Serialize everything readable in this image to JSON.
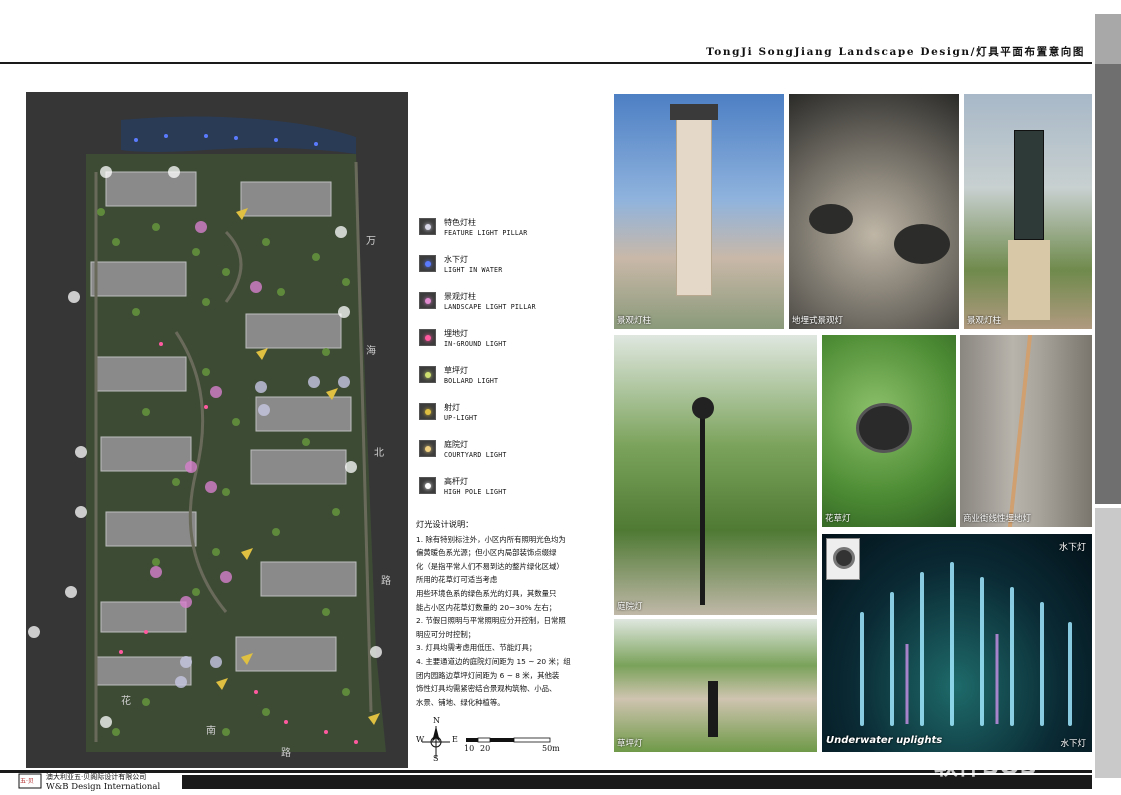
{
  "header": {
    "title": "TongJi SongJiang Landscape Design/灯具平面布置意向图"
  },
  "plan": {
    "roads": {
      "right_top": "万",
      "right_mid1": "海",
      "right_mid2": "北",
      "right_bottom": "路",
      "bottom1": "花",
      "bottom2": "南",
      "bottom3": "路"
    }
  },
  "legend": [
    {
      "cn": "特色灯柱",
      "en": "FEATURE LIGHT PILLAR",
      "color": "#d8d8e8"
    },
    {
      "cn": "水下灯",
      "en": "LIGHT IN WATER",
      "color": "#5a7bff"
    },
    {
      "cn": "景观灯柱",
      "en": "LANDSCAPE LIGHT PILLAR",
      "color": "#e08ad0"
    },
    {
      "cn": "埋地灯",
      "en": "IN-GROUND LIGHT",
      "color": "#ff5aa0"
    },
    {
      "cn": "草坪灯",
      "en": "BOLLARD LIGHT",
      "color": "#d0e070"
    },
    {
      "cn": "射灯",
      "en": "UP-LIGHT",
      "color": "#e0c040"
    },
    {
      "cn": "庭院灯",
      "en": "COURTYARD LIGHT",
      "color": "#f0d080"
    },
    {
      "cn": "高杆灯",
      "en": "HIGH POLE LIGHT",
      "color": "#ffffff"
    }
  ],
  "notes": {
    "title": "灯光设计说明：",
    "lines": [
      "1.  除有特别标注外，小区内所有照明光色均为",
      "     偏黄暖色系光源；但小区内局部装饰点缀绿",
      "     化（是指平常人们不易到达的整片绿化区域）",
      "     所用的花草灯可适当考虑",
      "     用些环境色系的绿色系光的灯具，其数量只",
      "     能占小区内花草灯数量的 20~30% 左右；",
      "2.  节假日照明与平常照明应分开控制，日常照",
      "     明应可分时控制；",
      "3.  灯具均需考虑用低压、节能灯具；",
      "4.  主要通道边的庭院灯间距为 15 ~ 20 米；组",
      "     团内园路边草坪灯间距为 6 ~ 8 米，其他装",
      "     饰性灯具均需紧密结合景观构筑物、小品、",
      "     水景、铺地、绿化种植等。"
    ]
  },
  "compass": {
    "n": "N",
    "s": "S",
    "e": "E",
    "w": "W",
    "scale_10": "10",
    "scale_20": "20",
    "scale_50": "50m"
  },
  "photos": {
    "p1": "景观灯柱",
    "p2": "地埋式景观灯",
    "p3": "景观灯柱",
    "p4": "庭院灯",
    "p5": "花草灯",
    "p6": "商业街线性埋地灯",
    "p7": "草坪灯",
    "p8_top": "水下灯",
    "p8_caption": "Underwater uplights",
    "p8_bottom": "水下灯"
  },
  "footer": {
    "company_cn": "澳大利亚五·贝阁际设计有限公司",
    "company_en": "W&B Design International",
    "logo_text": "五·贝"
  },
  "watermark": "软件SOS"
}
